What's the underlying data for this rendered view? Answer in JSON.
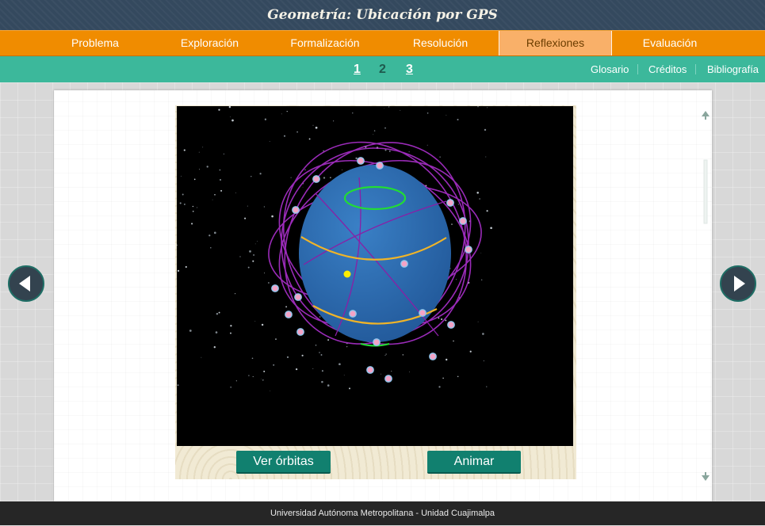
{
  "app": {
    "title": "Geometría: Ubicación por GPS"
  },
  "nav": {
    "items": [
      {
        "label": "Problema"
      },
      {
        "label": "Exploración"
      },
      {
        "label": "Formalización"
      },
      {
        "label": "Resolución"
      },
      {
        "label": "Reflexiones"
      },
      {
        "label": "Evaluación"
      }
    ],
    "active": "Reflexiones"
  },
  "pages": {
    "items": [
      "1",
      "2",
      "3"
    ],
    "current": "2"
  },
  "links": {
    "glossary": "Glosario",
    "credits": "Créditos",
    "bibliography": "Bibliografía"
  },
  "buttons": {
    "orbits": "Ver órbitas",
    "animate": "Animar"
  },
  "footer": {
    "text": "Universidad Autónoma Metropolitana - Unidad Cuajimalpa"
  },
  "colors": {
    "header": "#34495e",
    "nav": "#f08c00",
    "nav_active": "#f9b069",
    "subnav": "#3cb89b",
    "button": "#11806f",
    "earth": "#2f6fb4",
    "orbits": "#9a2bb8",
    "tropics": "#f0b428",
    "polar_circle": "#22dd33",
    "satellites": "#f4a3c6",
    "receiver": "#ffee00"
  },
  "icons": {
    "prev": "triangle-left-icon",
    "next": "triangle-right-icon",
    "scroll_up": "arrow-up-icon",
    "scroll_down": "arrow-down-icon"
  }
}
